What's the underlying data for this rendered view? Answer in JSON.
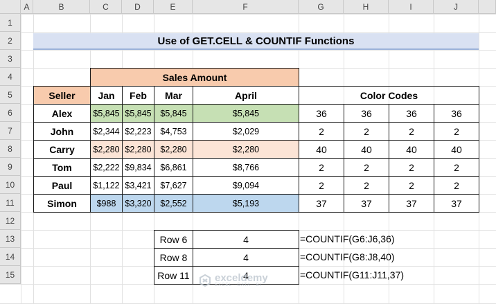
{
  "columns": [
    "A",
    "B",
    "C",
    "D",
    "E",
    "F",
    "G",
    "H",
    "I",
    "J"
  ],
  "rows": [
    "1",
    "2",
    "3",
    "4",
    "5",
    "6",
    "7",
    "8",
    "9",
    "10",
    "11",
    "12",
    "13",
    "14",
    "15"
  ],
  "title": "Use of GET.CELL & COUNTIF Functions",
  "table": {
    "sales_amount_header": "Sales Amount",
    "seller_header": "Seller",
    "month_headers": [
      "Jan",
      "Feb",
      "Mar",
      "April"
    ],
    "color_codes_header": "Color Codes",
    "rows": [
      {
        "seller": "Alex",
        "values": [
          "$5,845",
          "$5,845",
          "$5,845",
          "$5,845"
        ],
        "codes": [
          "36",
          "36",
          "36",
          "36"
        ],
        "fill": "#c6e0b4"
      },
      {
        "seller": "John",
        "values": [
          "$2,344",
          "$2,223",
          "$4,753",
          "$2,029"
        ],
        "codes": [
          "2",
          "2",
          "2",
          "2"
        ],
        "fill": ""
      },
      {
        "seller": "Carry",
        "values": [
          "$2,280",
          "$2,280",
          "$2,280",
          "$2,280"
        ],
        "codes": [
          "40",
          "40",
          "40",
          "40"
        ],
        "fill": "#fce4d6"
      },
      {
        "seller": "Tom",
        "values": [
          "$2,222",
          "$9,834",
          "$6,861",
          "$8,766"
        ],
        "codes": [
          "2",
          "2",
          "2",
          "2"
        ],
        "fill": ""
      },
      {
        "seller": "Paul",
        "values": [
          "$1,122",
          "$3,421",
          "$7,627",
          "$9,094"
        ],
        "codes": [
          "2",
          "2",
          "2",
          "2"
        ],
        "fill": ""
      },
      {
        "seller": "Simon",
        "values": [
          "$988",
          "$3,320",
          "$2,552",
          "$5,193"
        ],
        "codes": [
          "37",
          "37",
          "37",
          "37"
        ],
        "fill": "#bdd7ee"
      }
    ]
  },
  "summary": [
    {
      "label": "Row 6",
      "value": "4",
      "formula": "=COUNTIF(G6:J6,36)"
    },
    {
      "label": "Row 8",
      "value": "4",
      "formula": "=COUNTIF(G8:J8,40)"
    },
    {
      "label": "Row 11",
      "value": "4",
      "formula": "=COUNTIF(G11:J11,37)"
    }
  ],
  "watermark": {
    "name": "exceldemy",
    "tagline": "EXCEL · DATA · BI"
  },
  "colors": {
    "header_bg": "#e6e6e6",
    "title_bg": "#d9e1f2",
    "peach": "#f8cbad",
    "light_peach": "#fce4d6",
    "green": "#c6e0b4",
    "blue": "#bdd7ee"
  }
}
